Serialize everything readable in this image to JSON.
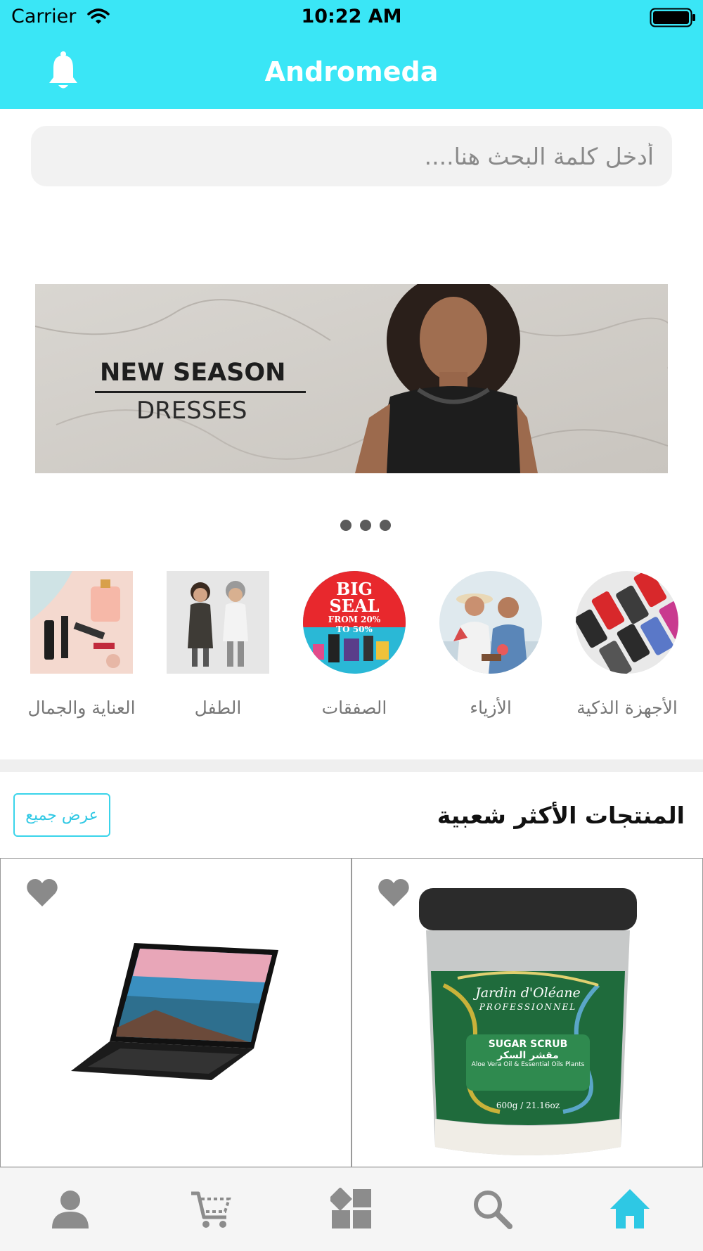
{
  "status_bar": {
    "carrier": "Carrier",
    "time": "10:22 AM"
  },
  "header": {
    "title": "Andromeda"
  },
  "search": {
    "placeholder": "أدخل كلمة البحث هنا...."
  },
  "banner": {
    "headline": "NEW SEASON",
    "subline": "DRESSES",
    "slide_count": 3
  },
  "categories": [
    {
      "label": "الأجهزة الذكية"
    },
    {
      "label": "الأزياء"
    },
    {
      "label": "الصفقات",
      "image_text_1": "BIG",
      "image_text_2": "SEAL",
      "image_text_3": "FROM 20%",
      "image_text_4": "TO 50%"
    },
    {
      "label": "الطفل"
    },
    {
      "label": "العناية والجمال"
    }
  ],
  "popular": {
    "title": "المنتجات الأكثر شعبية",
    "view_all": "عرض جميع",
    "products": [
      {
        "name": "laptop"
      },
      {
        "brand": "Jardin d'Oléane",
        "line": "PROFESSIONNEL",
        "label_en": "SUGAR SCRUB",
        "label_ar": "مقشر السكر",
        "desc": "Aloe Vera Oil & Essential Oils Plants",
        "weight": "600g / 21.16oz"
      }
    ]
  },
  "tabbar": {
    "items": [
      {
        "icon": "user-icon"
      },
      {
        "icon": "cart-icon"
      },
      {
        "icon": "grid-icon"
      },
      {
        "icon": "search-icon"
      },
      {
        "icon": "home-icon",
        "active": true
      }
    ]
  },
  "colors": {
    "accent": "#3ae6f6",
    "link": "#2ec8e4",
    "icon_inactive": "#8c8c8c"
  }
}
